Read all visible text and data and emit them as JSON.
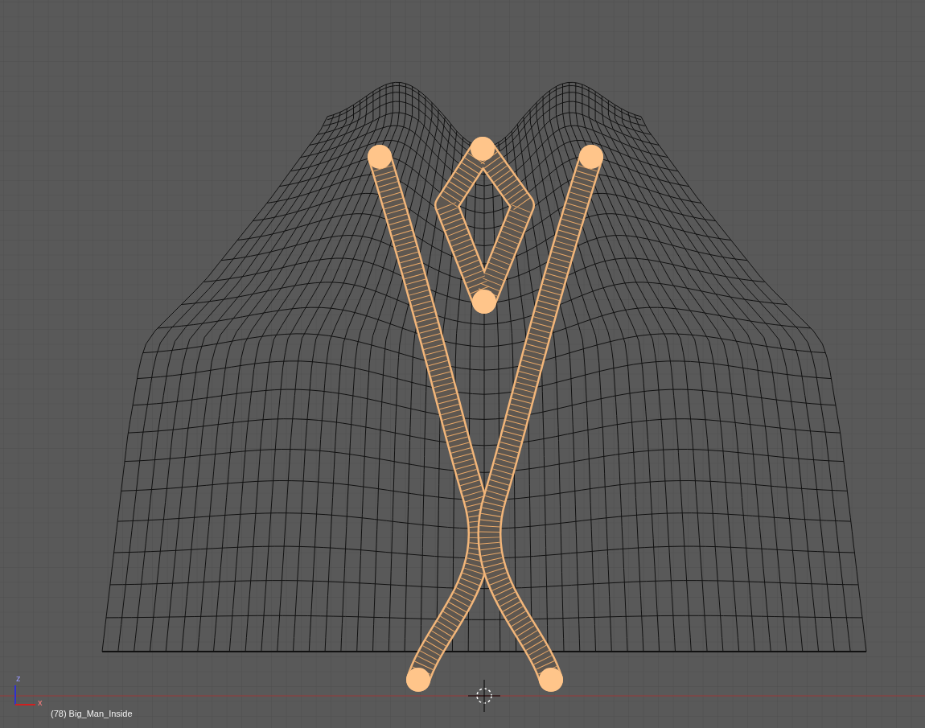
{
  "viewport": {
    "object_label": "(78) Big_Man_Inside",
    "axes": [
      {
        "label": "z"
      },
      {
        "label": "x"
      }
    ]
  }
}
